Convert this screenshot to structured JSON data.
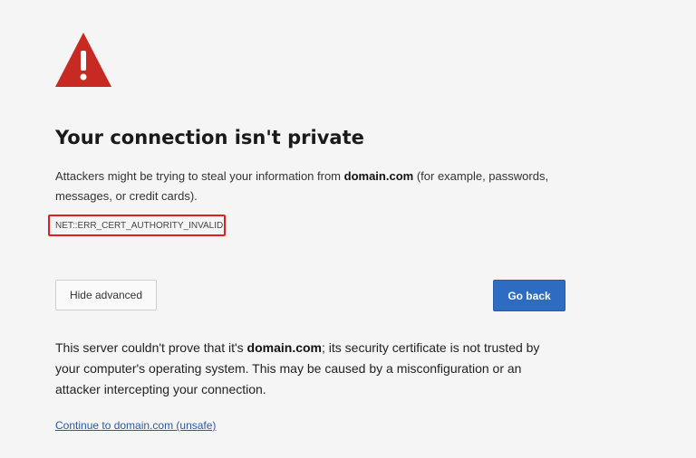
{
  "page": {
    "title": "Your connection isn't private",
    "description_prefix": "Attackers might be trying to steal your information from ",
    "description_domain": "domain.com",
    "description_suffix": " (for example, passwords, messages, or credit cards).",
    "error_code": "NET::ERR_CERT_AUTHORITY_INVALID"
  },
  "buttons": {
    "hide_advanced_label": "Hide advanced",
    "go_back_label": "Go back"
  },
  "advanced": {
    "text_prefix": "This server couldn't prove that it's ",
    "text_domain": "domain.com",
    "text_suffix": "; its security certificate is not trusted by your computer's operating system. This may be caused by a misconfiguration or an attacker intercepting your connection.",
    "proceed_link_label": "Continue to domain.com (unsafe)"
  },
  "icons": {
    "warning": "warning-triangle-icon"
  },
  "colors": {
    "warning_red": "#c62a22",
    "primary_button": "#2d6cc0",
    "highlight_border": "#e02020",
    "link": "#2a5aa5"
  }
}
